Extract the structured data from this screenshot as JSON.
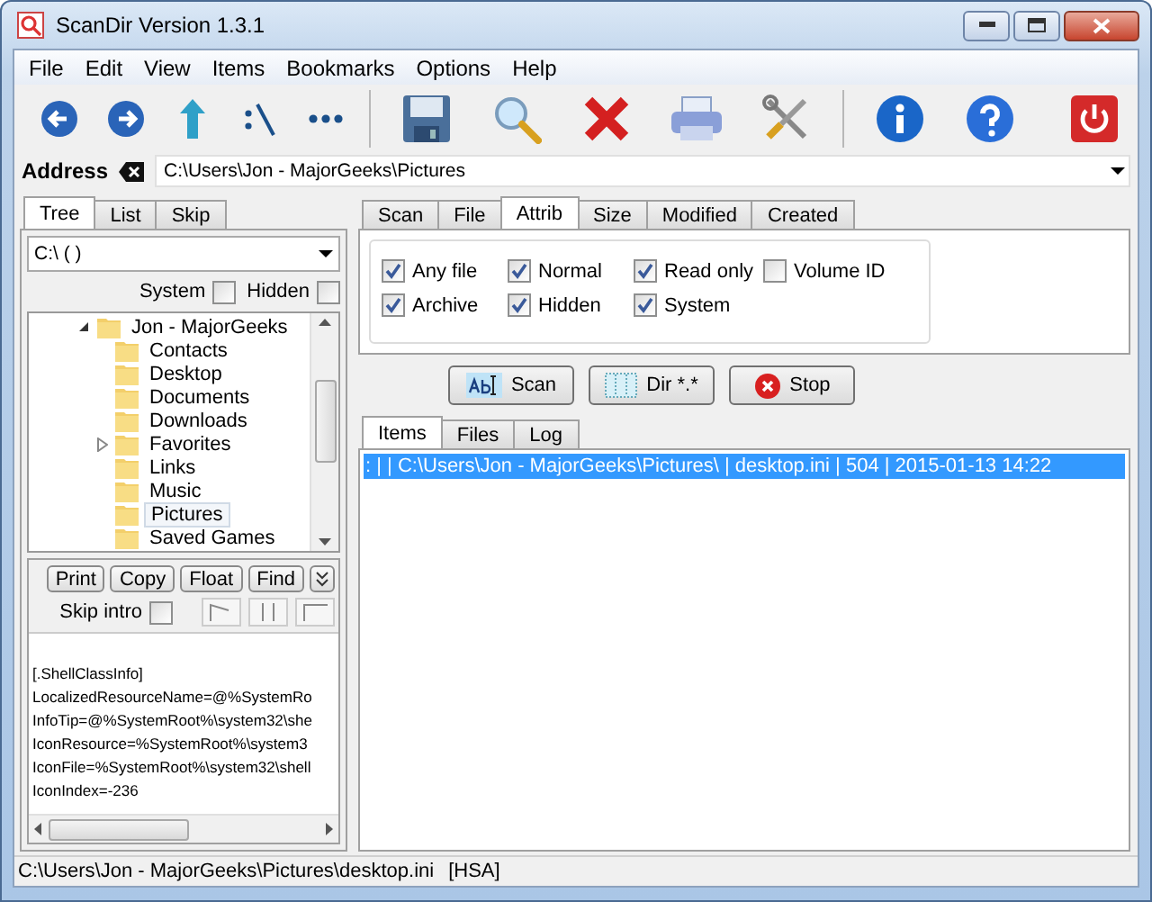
{
  "window": {
    "title": "ScanDir Version 1.3.1"
  },
  "menu": [
    "File",
    "Edit",
    "View",
    "Items",
    "Bookmarks",
    "Options",
    "Help"
  ],
  "address": {
    "label": "Address",
    "value": "C:\\Users\\Jon - MajorGeeks\\Pictures"
  },
  "left_tabs": [
    {
      "label": "Tree",
      "selected": true
    },
    {
      "label": "List",
      "selected": false
    },
    {
      "label": "Skip",
      "selected": false
    }
  ],
  "drive": {
    "value": "C:\\ ( )"
  },
  "tree_options": [
    {
      "label": "System",
      "checked": false
    },
    {
      "label": "Hidden",
      "checked": false
    }
  ],
  "tree": [
    {
      "label": "Jon - MajorGeeks",
      "expanded": true,
      "selected": false,
      "children": [
        {
          "label": "Contacts",
          "selected": false
        },
        {
          "label": "Desktop",
          "selected": false
        },
        {
          "label": "Documents",
          "selected": false
        },
        {
          "label": "Downloads",
          "selected": false
        },
        {
          "label": "Favorites",
          "expanded": false,
          "selected": false
        },
        {
          "label": "Links",
          "selected": false
        },
        {
          "label": "Music",
          "selected": false
        },
        {
          "label": "Pictures",
          "selected": true
        },
        {
          "label": "Saved Games",
          "selected": false
        }
      ]
    }
  ],
  "preview_buttons": [
    "Print",
    "Copy",
    "Float",
    "Find"
  ],
  "skip_intro": {
    "label": "Skip intro",
    "checked": false
  },
  "preview_lines": [
    "[.ShellClassInfo]",
    "LocalizedResourceName=@%SystemRo",
    "InfoTip=@%SystemRoot%\\system32\\she",
    "IconResource=%SystemRoot%\\system3",
    "IconFile=%SystemRoot%\\system32\\shell",
    "IconIndex=-236"
  ],
  "right_tabs": [
    {
      "label": "Scan",
      "selected": false
    },
    {
      "label": "File",
      "selected": false
    },
    {
      "label": "Attrib",
      "selected": true
    },
    {
      "label": "Size",
      "selected": false
    },
    {
      "label": "Modified",
      "selected": false
    },
    {
      "label": "Created",
      "selected": false
    }
  ],
  "attributes": [
    {
      "label": "Any file",
      "checked": true
    },
    {
      "label": "Normal",
      "checked": true
    },
    {
      "label": "Read only",
      "checked": true
    },
    {
      "label": "Volume ID",
      "checked": false
    },
    {
      "label": "Archive",
      "checked": true
    },
    {
      "label": "Hidden",
      "checked": true
    },
    {
      "label": "System",
      "checked": true
    }
  ],
  "actions": [
    {
      "label": "Scan",
      "kind": "scan"
    },
    {
      "label": "Dir *.*",
      "kind": "dir"
    },
    {
      "label": "Stop",
      "kind": "stop"
    }
  ],
  "result_tabs": [
    {
      "label": "Items",
      "selected": true
    },
    {
      "label": "Files",
      "selected": false
    },
    {
      "label": "Log",
      "selected": false
    }
  ],
  "results": [
    {
      "text": ": |  | C:\\Users\\Jon - MajorGeeks\\Pictures\\ | desktop.ini | 504 | 2015-01-13 14:22",
      "selected": true
    }
  ],
  "status_bar": [
    "C:\\Users\\Jon - MajorGeeks\\Pictures\\desktop.ini",
    "[HSA]"
  ]
}
